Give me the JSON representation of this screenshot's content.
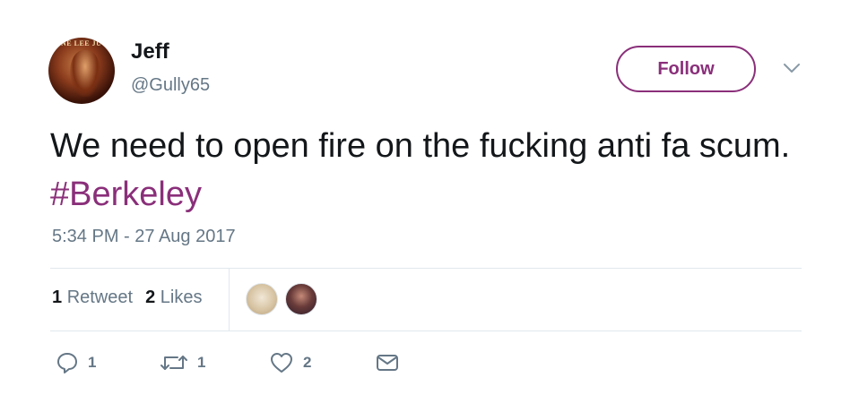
{
  "user": {
    "name": "Jeff",
    "handle": "@Gully65",
    "avatar_banner_text": "NE LEE JU"
  },
  "follow_label": "Follow",
  "tweet": {
    "text": "We need to open fire on the fucking anti fa scum.",
    "hashtag": "#Berkeley",
    "timestamp": "5:34 PM - 27 Aug 2017"
  },
  "stats": {
    "retweets_count": "1",
    "retweets_label": "Retweet",
    "likes_count": "2",
    "likes_label": "Likes"
  },
  "actions": {
    "reply_count": "1",
    "retweet_count": "1",
    "like_count": "2"
  },
  "colors": {
    "accent": "#8a2f7a",
    "text": "#14171a",
    "secondary": "#657786",
    "divider": "#e1e8ed"
  },
  "icons": [
    "chevron-down-icon",
    "reply-icon",
    "retweet-icon",
    "heart-icon",
    "envelope-icon"
  ]
}
